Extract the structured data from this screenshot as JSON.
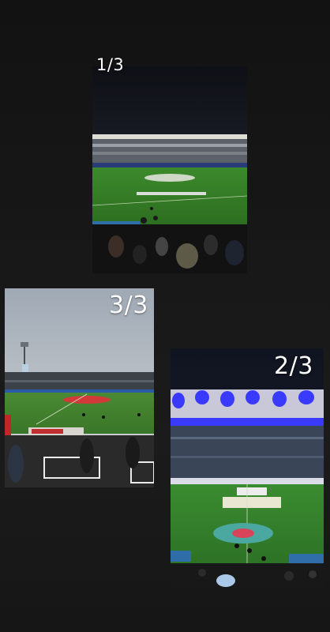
{
  "story": {
    "photos": [
      {
        "counter": "1/3",
        "subject": "stadium-night-photo"
      },
      {
        "counter": "2/3",
        "subject": "stadium-blue-lights-photo"
      },
      {
        "counter": "3/3",
        "subject": "stadium-day-photo"
      }
    ]
  },
  "colors": {
    "background": "#1a1a1a",
    "pitch_green": "#2f7a2a",
    "night_sky": "#12141c",
    "stand_lights_blue": "#3a3aff",
    "day_sky": "#b9c2cc"
  }
}
